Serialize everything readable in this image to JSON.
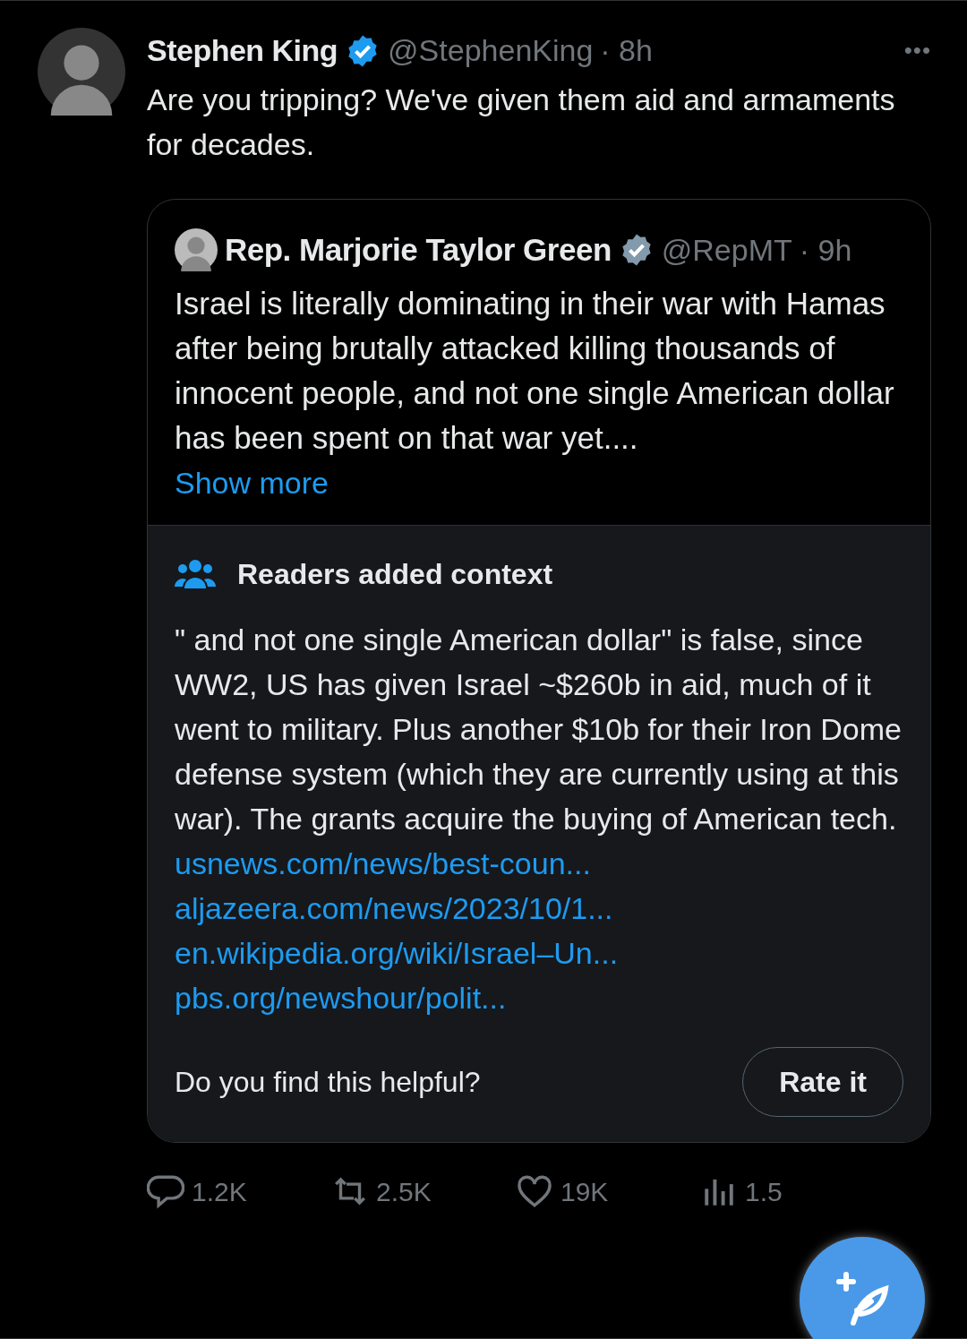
{
  "tweet": {
    "author": {
      "name": "Stephen King",
      "verified": true,
      "handle": "@StephenKing",
      "time": "· 8h"
    },
    "more_menu": "•••",
    "text": "Are you tripping? We've given them aid and armaments for decades.",
    "quote": {
      "author": {
        "name": "Rep. Marjorie Taylor Green",
        "verified": true,
        "handle": "@RepMT",
        "time": "· 9h"
      },
      "text": "Israel is literally dominating in their war with Hamas after being brutally attacked killing thousands of innocent people, and not one single American dollar has been spent on that war yet....",
      "show_more": "Show more",
      "note": {
        "title": "Readers added context",
        "text": "\" and not one single American dollar\" is false, since WW2, US has given Israel ~$260b in aid, much of it went to military. Plus another $10b for their Iron Dome defense system (which they are currently using at this war). The grants acquire the buying of American tech.",
        "links": [
          "usnews.com/news/best-coun...",
          "aljazeera.com/news/2023/10/1...",
          "en.wikipedia.org/wiki/Israel–Un...",
          "pbs.org/newshour/polit..."
        ],
        "question": "Do you find this helpful?",
        "button": "Rate it"
      }
    },
    "actions": [
      {
        "kind": "reply",
        "count": "1.2K"
      },
      {
        "kind": "repost",
        "count": "2.5K"
      },
      {
        "kind": "like",
        "count": "19K"
      },
      {
        "kind": "views",
        "count": "1.5"
      }
    ]
  }
}
